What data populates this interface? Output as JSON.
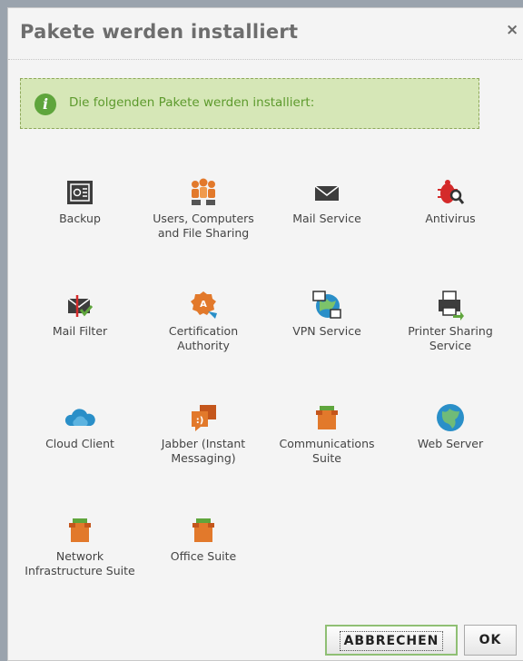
{
  "dialog": {
    "title": "Pakete werden installiert",
    "close_glyph": "×",
    "info_glyph": "i",
    "info_text": "Die folgenden Pakete werden installiert:"
  },
  "packages": [
    {
      "label": "Backup",
      "icon": "backup-icon"
    },
    {
      "label": "Users, Computers and File Sharing",
      "icon": "users-icon"
    },
    {
      "label": "Mail Service",
      "icon": "mail-icon"
    },
    {
      "label": "Antivirus",
      "icon": "antivirus-icon"
    },
    {
      "label": "Mail Filter",
      "icon": "mail-filter-icon"
    },
    {
      "label": "Certification Authority",
      "icon": "certificate-icon"
    },
    {
      "label": "VPN Service",
      "icon": "vpn-icon"
    },
    {
      "label": "Printer Sharing Service",
      "icon": "printer-icon"
    },
    {
      "label": "Cloud Client",
      "icon": "cloud-icon"
    },
    {
      "label": "Jabber (Instant Messaging)",
      "icon": "chat-icon"
    },
    {
      "label": "Communications Suite",
      "icon": "package-box-icon"
    },
    {
      "label": "Web Server",
      "icon": "globe-icon"
    },
    {
      "label": "Network Infrastructure Suite",
      "icon": "package-box-icon"
    },
    {
      "label": "Office Suite",
      "icon": "package-box-icon"
    }
  ],
  "buttons": {
    "cancel": "ABBRECHEN",
    "ok": "OK"
  },
  "colors": {
    "info_bg": "#d6e7b7",
    "info_text": "#5d9a2d",
    "accent_orange": "#e2792b",
    "accent_blue": "#2a8fc8"
  }
}
